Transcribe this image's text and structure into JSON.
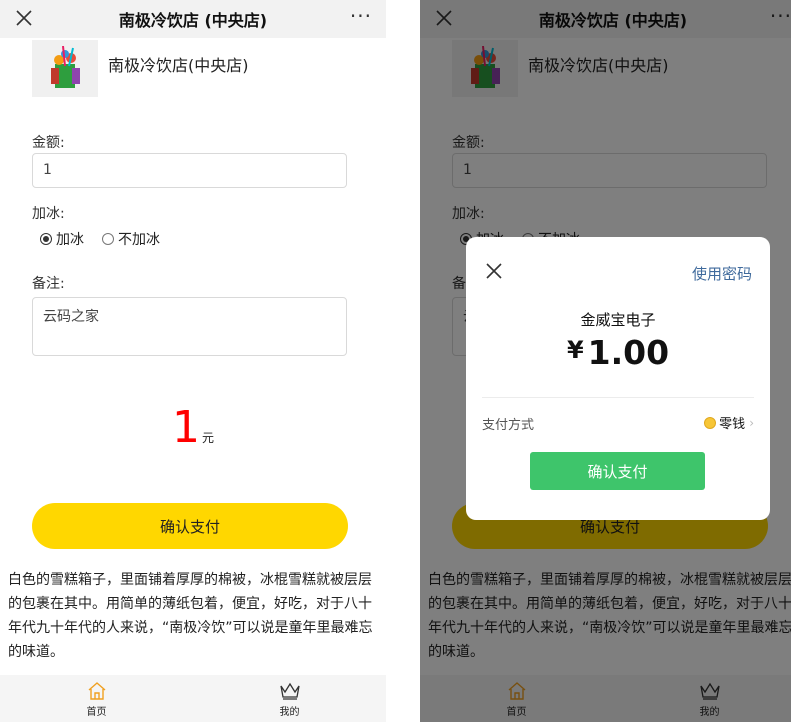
{
  "shop": {
    "title": "南极冷饮店 (中央店)",
    "name": "南极冷饮店(中央店)",
    "more": "···"
  },
  "form": {
    "amount_label": "金额:",
    "amount_value": "1",
    "ice_label": "加冰:",
    "ice_options": [
      "加冰",
      "不加冰"
    ],
    "ice_selected": "加冰",
    "note_label": "备注:",
    "note_value": "云码之家"
  },
  "amount_display": {
    "value": "1",
    "unit": "元"
  },
  "pay_button": "确认支付",
  "description": "白色的雪糕箱子，里面铺着厚厚的棉被，冰棍雪糕就被层层的包裹在其中。用简单的薄纸包着，便宜，好吃，对于八十年代九十年代的人来说，“南极冷饮”可以说是童年里最难忘的味道。",
  "tabbar": [
    {
      "label": "首页",
      "icon": "home-icon"
    },
    {
      "label": "我的",
      "icon": "crown-icon"
    }
  ],
  "colors": {
    "accent_yellow": "#ffd700",
    "amount_red": "#ff0000",
    "confirm_green": "#3ec56b",
    "link_blue": "#3f6a9c"
  },
  "payment_modal": {
    "use_password": "使用密码",
    "merchant": "金威宝电子",
    "currency": "¥",
    "amount": "1.00",
    "method_label": "支付方式",
    "method_value": "零钱",
    "confirm": "确认支付"
  }
}
